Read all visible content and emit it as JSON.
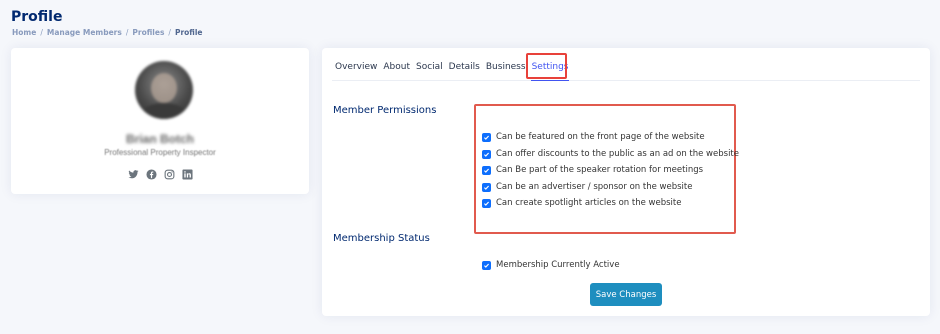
{
  "header": {
    "title": "Profile",
    "breadcrumb": [
      "Home",
      "Manage Members",
      "Profiles",
      "Profile"
    ],
    "separator": "/"
  },
  "profile": {
    "name": "Brian Botch",
    "role": "Professional Property Inspector",
    "social_icons": [
      "twitter-icon",
      "facebook-icon",
      "instagram-icon",
      "linkedin-icon"
    ]
  },
  "tabs": [
    {
      "label": "Overview",
      "active": false
    },
    {
      "label": "About",
      "active": false
    },
    {
      "label": "Social",
      "active": false
    },
    {
      "label": "Details",
      "active": false
    },
    {
      "label": "Business",
      "active": false
    },
    {
      "label": "Settings",
      "active": true
    }
  ],
  "permissions": {
    "title": "Member Permissions",
    "items": [
      {
        "label": "Can be featured on the front page of the website",
        "checked": true
      },
      {
        "label": "Can offer discounts to the public as an ad on the website",
        "checked": true
      },
      {
        "label": "Can Be part of the speaker rotation for meetings",
        "checked": true
      },
      {
        "label": "Can be an advertiser / sponsor on the website",
        "checked": true
      },
      {
        "label": "Can create spotlight articles on the website",
        "checked": true
      }
    ]
  },
  "membership": {
    "title": "Membership Status",
    "item": {
      "label": "Membership Currently Active",
      "checked": true
    }
  },
  "actions": {
    "save_label": "Save Changes"
  },
  "colors": {
    "accent": "#4154f1",
    "checkbox": "#0d6efd",
    "button": "#1e8ebf",
    "highlight": "#e8413a",
    "title": "#012970"
  }
}
